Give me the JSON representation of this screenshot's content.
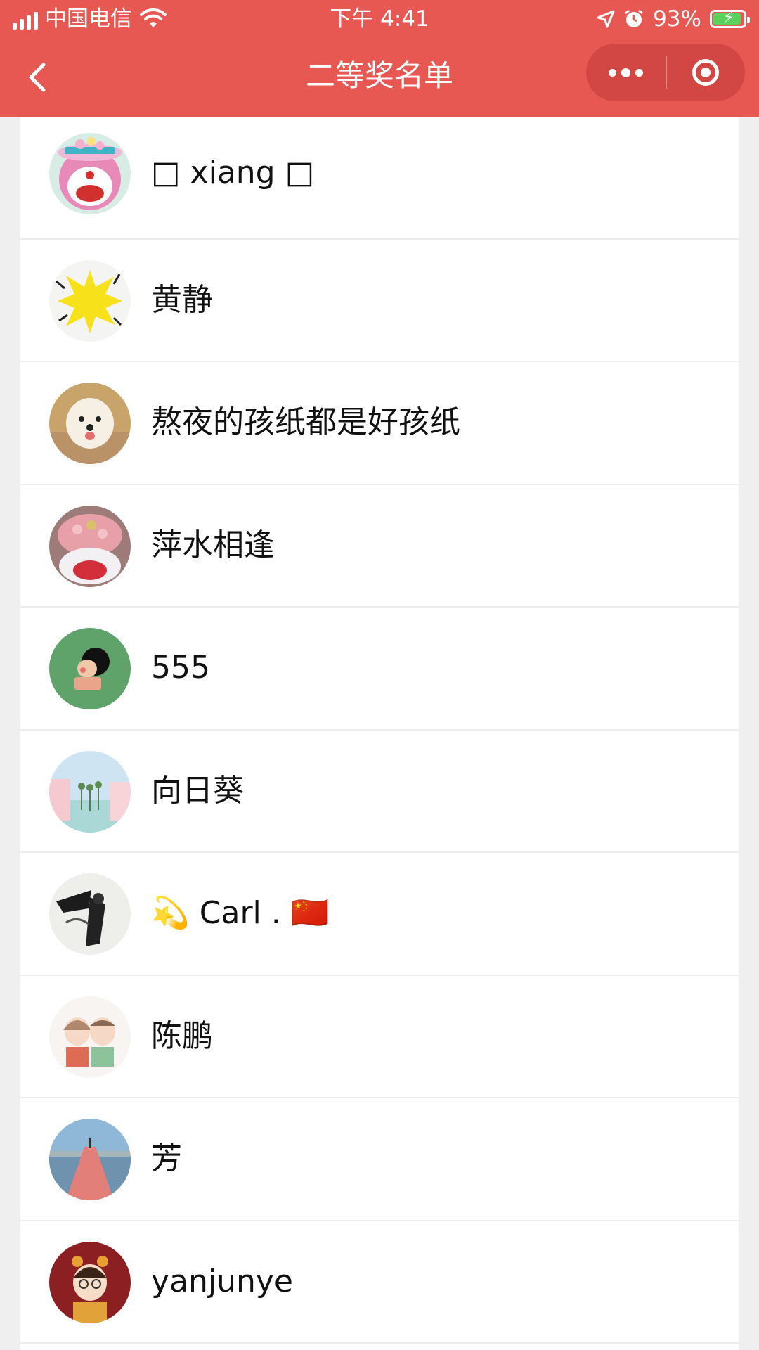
{
  "status_bar": {
    "carrier": "中国电信",
    "time": "下午 4:41",
    "battery": "93%",
    "battery_level": 0.93
  },
  "nav": {
    "title": "二等奖名单"
  },
  "winners": [
    {
      "name": "□  xiang □",
      "avatar": "doraemon-avatar"
    },
    {
      "name": "黄静",
      "avatar": "burst-star-avatar"
    },
    {
      "name": "熬夜的孩纸都是好孩纸",
      "avatar": "puppy-avatar"
    },
    {
      "name": "萍水相逢",
      "avatar": "flower-bouquet-avatar"
    },
    {
      "name": "555",
      "avatar": "cartoon-kid-avatar"
    },
    {
      "name": "向日葵",
      "avatar": "palm-street-avatar"
    },
    {
      "name": "💫 Carl . 🇨🇳",
      "avatar": "ink-warrior-avatar"
    },
    {
      "name": "陈鹏",
      "avatar": "couple-cartoon-avatar"
    },
    {
      "name": "芳",
      "avatar": "pier-sea-avatar"
    },
    {
      "name": "yanjunye",
      "avatar": "cartoon-girl-avatar"
    }
  ]
}
